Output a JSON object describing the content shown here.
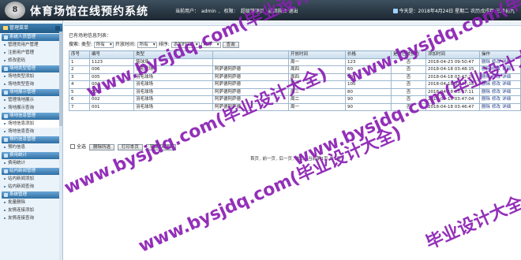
{
  "header": {
    "logo_text": "8",
    "title": "体育场馆在线预约系统",
    "current_user_label": "当前用户：",
    "username": "admin",
    "role_label": "权限：",
    "role": "超级管理员",
    "home_link": "返回前台",
    "logout_link": "退出",
    "date_text": "今天是：2018年4月24日 星期二 农历戊戌年 三月初九"
  },
  "sidebar": {
    "title": "管理菜单",
    "groups": [
      {
        "title": "系统人员管理",
        "items": [
          "管理员用户管理",
          "注册用户管理",
          "修改密码"
        ]
      },
      {
        "title": "场地类型管理",
        "items": [
          "场地类型添加",
          "场地类型查询"
        ]
      },
      {
        "title": "场地展示管理",
        "items": [
          "管理场地展示",
          "场地展示查询"
        ]
      },
      {
        "title": "场地信息管理",
        "items": [
          "场地信息添加",
          "场地信息查询"
        ]
      },
      {
        "title": "预约信息管理",
        "items": [
          "预约信息"
        ]
      },
      {
        "title": "费用统计",
        "items": [
          "费用统计"
        ]
      },
      {
        "title": "站内新闻管理",
        "items": [
          "站内新闻添加",
          "站内新闻查询"
        ]
      },
      {
        "title": "系统管理",
        "items": [
          "批量删除",
          "友情连接添加",
          "友情连接查询"
        ]
      }
    ]
  },
  "main": {
    "caption": "已有场地信息列表：",
    "filter": {
      "search_label": "搜索:",
      "type_label": "类型",
      "type_value": "所有",
      "open_label": "开放时间",
      "open_value": "所有",
      "sort_label": "排序",
      "sort_value": "添加时间",
      "order_value": "降序",
      "query_button": "查询"
    },
    "columns": [
      "序号",
      "编号",
      "类型",
      "",
      "开放时间",
      "价格",
      "是否已被预约",
      "添加时间",
      "操作"
    ],
    "rows": [
      {
        "no": "1",
        "code": "1123",
        "type": "篮球场",
        "desc": "",
        "open": "周一",
        "price": "123",
        "booked": "否",
        "added": "2018-04-23 09:50:47"
      },
      {
        "no": "2",
        "code": "006",
        "type": "羽毛球场",
        "desc": "阿萨德阿萨德",
        "open": "周四",
        "price": "60",
        "booked": "否",
        "added": "2018-04-18 03:48:15"
      },
      {
        "no": "3",
        "code": "005",
        "type": "羽毛球场",
        "desc": "阿萨德阿萨德",
        "open": "周四",
        "price": "90",
        "booked": "否",
        "added": "2018-04-18 03:47:26"
      },
      {
        "no": "4",
        "code": "004",
        "type": "羽毛球场",
        "desc": "阿萨德阿萨德",
        "open": "周一",
        "price": "100",
        "booked": "否",
        "added": "2018-04-18 03:47:18"
      },
      {
        "no": "5",
        "code": "003",
        "type": "羽毛球场",
        "desc": "阿萨德阿萨德",
        "open": "周三",
        "price": "80",
        "booked": "否",
        "added": "2018-04-18 03:47:11"
      },
      {
        "no": "6",
        "code": "002",
        "type": "羽毛球场",
        "desc": "阿萨德阿萨德",
        "open": "周二",
        "price": "90",
        "booked": "否",
        "added": "2018-04-18 03:47:04"
      },
      {
        "no": "7",
        "code": "001",
        "type": "羽毛球场",
        "desc": "阿萨德阿萨德",
        "open": "周一",
        "price": "90",
        "booked": "否",
        "added": "2018-04-18 03:46:47"
      }
    ],
    "row_ops": [
      "删除",
      "修改",
      "详细"
    ],
    "batch": {
      "select_all": "全选",
      "delete_selected": "删除所选",
      "print": "打印本页",
      "export": "导出EXCEL"
    },
    "pager": {
      "first": "首页",
      "prev": "前一页",
      "next": "后一页",
      "last": "末页",
      "status": "当前第1页,共1页"
    }
  },
  "watermarks": [
    "www.bysjdq.com(毕业设计大全)",
    "www.bysjdq.com(毕业设计大全)",
    "www.bysjdq.com(毕业设计大全)",
    "www.bysjdq.com(毕业设计大全)",
    "www.bysjdq.com(毕业设计大全)",
    "毕业设计大全"
  ]
}
